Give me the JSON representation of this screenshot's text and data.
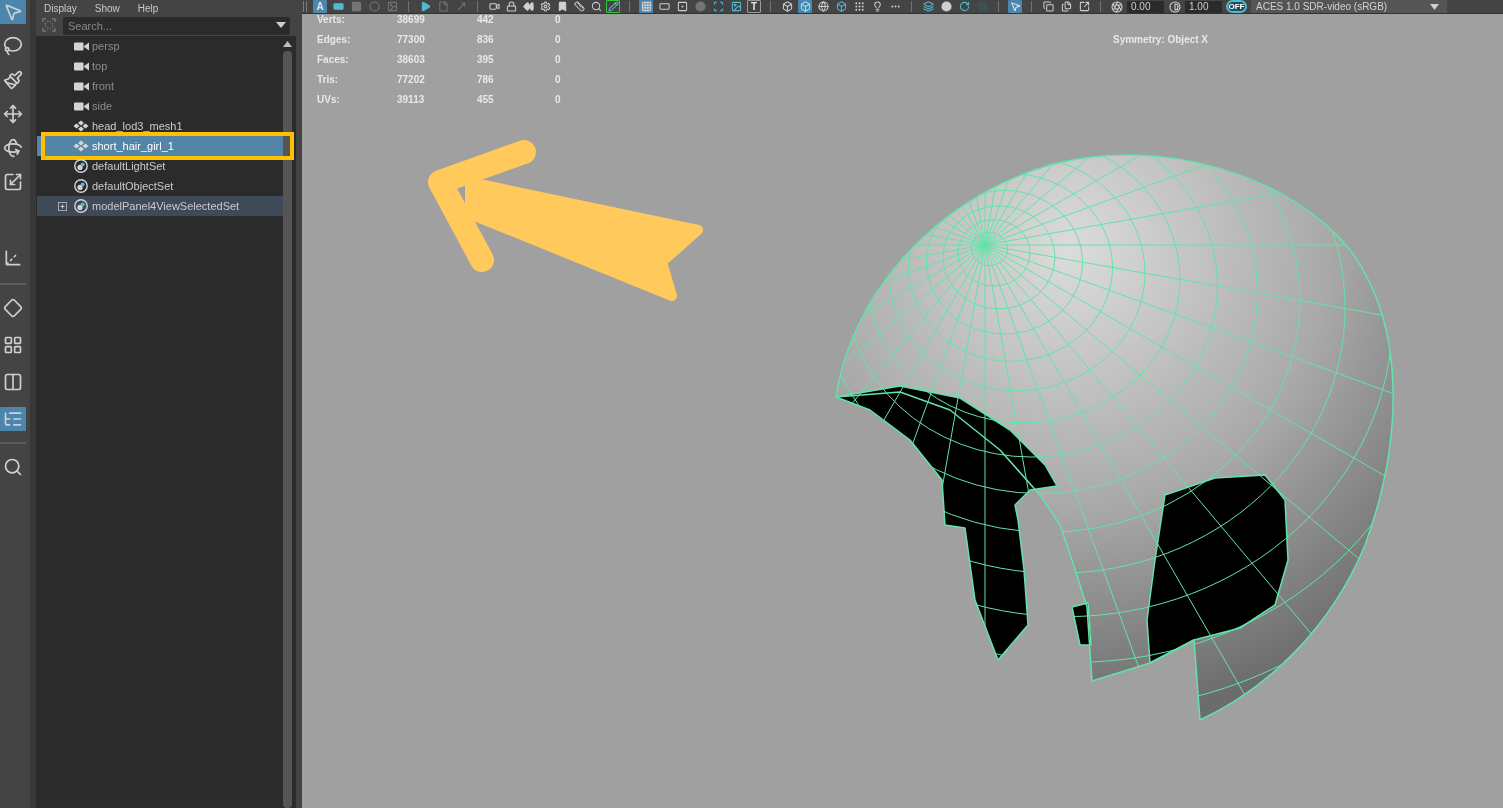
{
  "toolbox": {
    "tools": [
      {
        "selected": true
      },
      {
        "selected": false
      },
      {
        "selected": false
      },
      {
        "selected": false
      },
      {
        "selected": false
      },
      {
        "selected": false
      }
    ],
    "panel_layouts": [
      {
        "selected": false
      },
      {
        "selected": false
      },
      {
        "selected": false
      },
      {
        "selected": true
      }
    ]
  },
  "outliner": {
    "menu": [
      "Display",
      "Show",
      "Help"
    ],
    "search": {
      "placeholder": "Search..."
    },
    "items": [
      {
        "label": "persp",
        "kind": "camera",
        "hidden": true,
        "selected": false,
        "highlighted": false,
        "marked": false,
        "has_children": false
      },
      {
        "label": "top",
        "kind": "camera",
        "hidden": true,
        "selected": false,
        "highlighted": false,
        "marked": false,
        "has_children": false
      },
      {
        "label": "front",
        "kind": "camera",
        "hidden": true,
        "selected": false,
        "highlighted": false,
        "marked": false,
        "has_children": false
      },
      {
        "label": "side",
        "kind": "camera",
        "hidden": true,
        "selected": false,
        "highlighted": false,
        "marked": false,
        "has_children": false
      },
      {
        "label": "head_lod3_mesh1",
        "kind": "mesh",
        "hidden": false,
        "selected": false,
        "highlighted": false,
        "marked": false,
        "has_children": false
      },
      {
        "label": "short_hair_girl_1",
        "kind": "mesh",
        "hidden": false,
        "selected": true,
        "highlighted": false,
        "marked": true,
        "has_children": false
      },
      {
        "label": "defaultLightSet",
        "kind": "set",
        "hidden": false,
        "selected": false,
        "highlighted": false,
        "marked": false,
        "has_children": false
      },
      {
        "label": "defaultObjectSet",
        "kind": "set",
        "hidden": false,
        "selected": false,
        "highlighted": false,
        "marked": false,
        "has_children": false
      },
      {
        "label": "modelPanel4ViewSelectedSet",
        "kind": "set",
        "hidden": false,
        "selected": false,
        "highlighted": true,
        "marked": false,
        "has_children": true,
        "expanded": false
      }
    ]
  },
  "viewport": {
    "toolbar": {
      "groups": [
        [
          {
            "glyph": "A",
            "on": true,
            "disabled": false
          },
          {
            "on": false,
            "disabled": false
          },
          {
            "on": false,
            "disabled": true
          },
          {
            "on": false,
            "disabled": true
          },
          {
            "on": false,
            "disabled": true
          }
        ],
        [
          {
            "on": false,
            "disabled": false
          },
          {
            "on": false,
            "disabled": true
          },
          {
            "on": false,
            "disabled": true
          }
        ],
        [
          {
            "on": false,
            "disabled": false
          },
          {
            "on": false,
            "disabled": false
          },
          {
            "on": false,
            "disabled": false
          },
          {
            "on": false,
            "disabled": false
          },
          {
            "on": false,
            "disabled": false
          },
          {
            "on": false,
            "disabled": false
          },
          {
            "on": false,
            "disabled": false
          },
          {
            "on": false,
            "disabled": false
          }
        ],
        [
          {
            "on": true,
            "disabled": false
          },
          {
            "on": false,
            "disabled": false
          },
          {
            "on": false,
            "disabled": false
          },
          {
            "on": false,
            "disabled": true
          },
          {
            "on": false,
            "disabled": false
          },
          {
            "on": false,
            "disabled": false
          },
          {
            "glyph": "T",
            "on": false,
            "disabled": false
          }
        ],
        [
          {
            "on": false,
            "disabled": false
          },
          {
            "on": true,
            "disabled": false
          },
          {
            "on": false,
            "disabled": false
          },
          {
            "on": false,
            "disabled": false
          },
          {
            "on": false,
            "disabled": false
          },
          {
            "on": false,
            "disabled": false
          },
          {
            "on": false,
            "disabled": false
          }
        ],
        [
          {
            "on": false,
            "disabled": false
          },
          {
            "on": false,
            "disabled": false
          },
          {
            "on": false,
            "disabled": false
          },
          {
            "on": false,
            "disabled": true
          }
        ],
        [
          {
            "on": true,
            "disabled": false
          }
        ],
        [
          {
            "on": false,
            "disabled": false
          },
          {
            "on": false,
            "disabled": false
          },
          {
            "on": false,
            "disabled": false
          }
        ]
      ],
      "fields": [
        "0.00",
        "1.00"
      ],
      "color_toggle": "OFF",
      "color_space": "ACES 1.0 SDR-video (sRGB)"
    },
    "hud": {
      "rows": [
        {
          "label": "Verts:",
          "values": [
            "38699",
            "442",
            "0"
          ]
        },
        {
          "label": "Edges:",
          "values": [
            "77300",
            "836",
            "0"
          ]
        },
        {
          "label": "Faces:",
          "values": [
            "38603",
            "395",
            "0"
          ]
        },
        {
          "label": "Tris:",
          "values": [
            "77202",
            "786",
            "0"
          ]
        },
        {
          "label": "UVs:",
          "values": [
            "39113",
            "455",
            "0"
          ]
        }
      ]
    },
    "symmetry": "Symmetry: Object X"
  }
}
